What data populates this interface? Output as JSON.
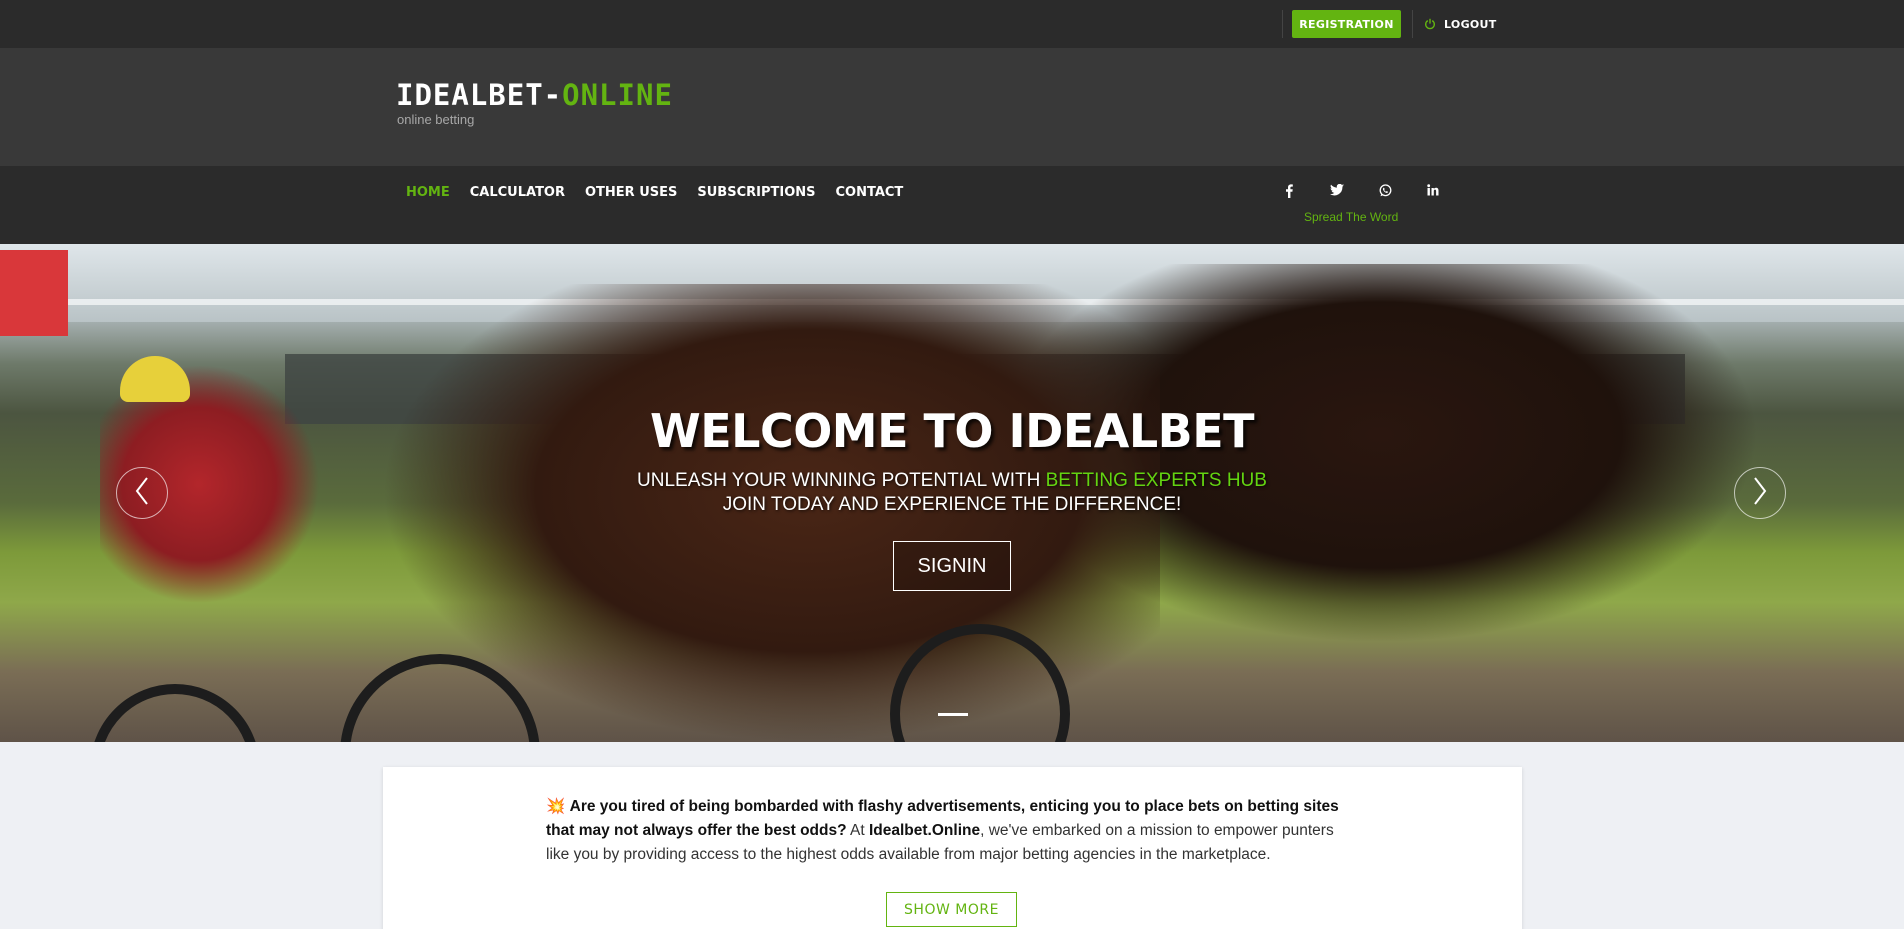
{
  "topbar": {
    "registration_label": "REGISTRATION",
    "logout_label": "LOGOUT",
    "logout_icon": "power-icon"
  },
  "header": {
    "logo_part1": "IDEALBET-",
    "logo_part2": "ONLINE",
    "tagline": "online betting"
  },
  "nav": {
    "items": [
      {
        "label": "HOME",
        "active": true
      },
      {
        "label": "CALCULATOR"
      },
      {
        "label": "OTHER USES"
      },
      {
        "label": "SUBSCRIPTIONS"
      },
      {
        "label": "CONTACT"
      }
    ],
    "social_icons": [
      "facebook-icon",
      "twitter-icon",
      "whatsapp-icon",
      "linkedin-icon"
    ],
    "spread_text": "Spread The Word"
  },
  "hero": {
    "title": "WELCOME TO IDEALBET",
    "subtitle_prefix": "UNLEASH YOUR WINNING POTENTIAL WITH ",
    "subtitle_highlight": "BETTING EXPERTS HUB",
    "subtitle_line2": "JOIN TODAY AND EXPERIENCE THE DIFFERENCE!",
    "signin_label": "SIGNIN"
  },
  "intro": {
    "emoji": "💥",
    "bold_text": "Are you tired of being bombarded with flashy advertisements, enticing you to place bets on betting sites that may not always offer the best odds?",
    "text_a": " At ",
    "brand": "Idealbet.Online",
    "text_b": ", we've embarked on a mission to empower punters like you by providing access to the highest odds available from major betting agencies in the marketplace.",
    "show_more_label": "SHOW MORE"
  },
  "colors": {
    "accent": "#63b411",
    "topbar": "#2b2b2b",
    "header": "#393939"
  }
}
